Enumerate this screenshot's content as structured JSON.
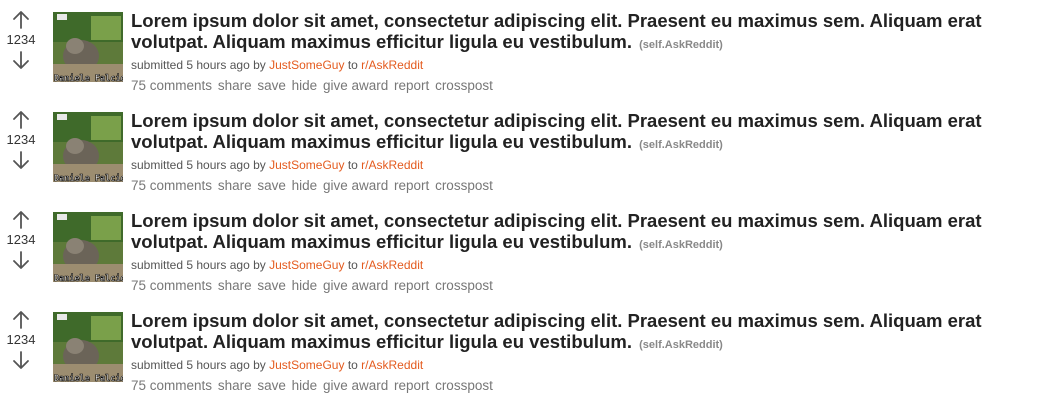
{
  "posts": [
    {
      "score": "1234",
      "title": "Lorem ipsum dolor sit amet, consectetur adipiscing elit. Praesent eu maximus sem. Aliquam erat volutpat. Aliquam maximus efficitur ligula eu vestibulum.",
      "domain": "(self.AskReddit)",
      "submitted": "submitted 5 hours ago by",
      "author": "JustSomeGuy",
      "to": "to",
      "subreddit": "r/AskReddit",
      "thumb_text": "Daniele Falcio",
      "buttons": {
        "comments": "75 comments",
        "share": "share",
        "save": "save",
        "hide": "hide",
        "award": "give award",
        "report": "report",
        "crosspost": "crosspost"
      }
    },
    {
      "score": "1234",
      "title": "Lorem ipsum dolor sit amet, consectetur adipiscing elit. Praesent eu maximus sem. Aliquam erat volutpat. Aliquam maximus efficitur ligula eu vestibulum.",
      "domain": "(self.AskReddit)",
      "submitted": "submitted 5 hours ago by",
      "author": "JustSomeGuy",
      "to": "to",
      "subreddit": "r/AskReddit",
      "thumb_text": "Daniele Falcio",
      "buttons": {
        "comments": "75 comments",
        "share": "share",
        "save": "save",
        "hide": "hide",
        "award": "give award",
        "report": "report",
        "crosspost": "crosspost"
      }
    },
    {
      "score": "1234",
      "title": "Lorem ipsum dolor sit amet, consectetur adipiscing elit. Praesent eu maximus sem. Aliquam erat volutpat. Aliquam maximus efficitur ligula eu vestibulum.",
      "domain": "(self.AskReddit)",
      "submitted": "submitted 5 hours ago by",
      "author": "JustSomeGuy",
      "to": "to",
      "subreddit": "r/AskReddit",
      "thumb_text": "Daniele Falcio",
      "buttons": {
        "comments": "75 comments",
        "share": "share",
        "save": "save",
        "hide": "hide",
        "award": "give award",
        "report": "report",
        "crosspost": "crosspost"
      }
    },
    {
      "score": "1234",
      "title": "Lorem ipsum dolor sit amet, consectetur adipiscing elit. Praesent eu maximus sem. Aliquam erat volutpat. Aliquam maximus efficitur ligula eu vestibulum.",
      "domain": "(self.AskReddit)",
      "submitted": "submitted 5 hours ago by",
      "author": "JustSomeGuy",
      "to": "to",
      "subreddit": "r/AskReddit",
      "thumb_text": "Daniele Falcio",
      "buttons": {
        "comments": "75 comments",
        "share": "share",
        "save": "save",
        "hide": "hide",
        "award": "give award",
        "report": "report",
        "crosspost": "crosspost"
      }
    }
  ],
  "icons": {
    "upvote": "arrow-up-icon",
    "downvote": "arrow-down-icon"
  },
  "colors": {
    "link": "#e45b1f",
    "title": "#222222",
    "meta": "#555555",
    "buttons": "#777777"
  }
}
